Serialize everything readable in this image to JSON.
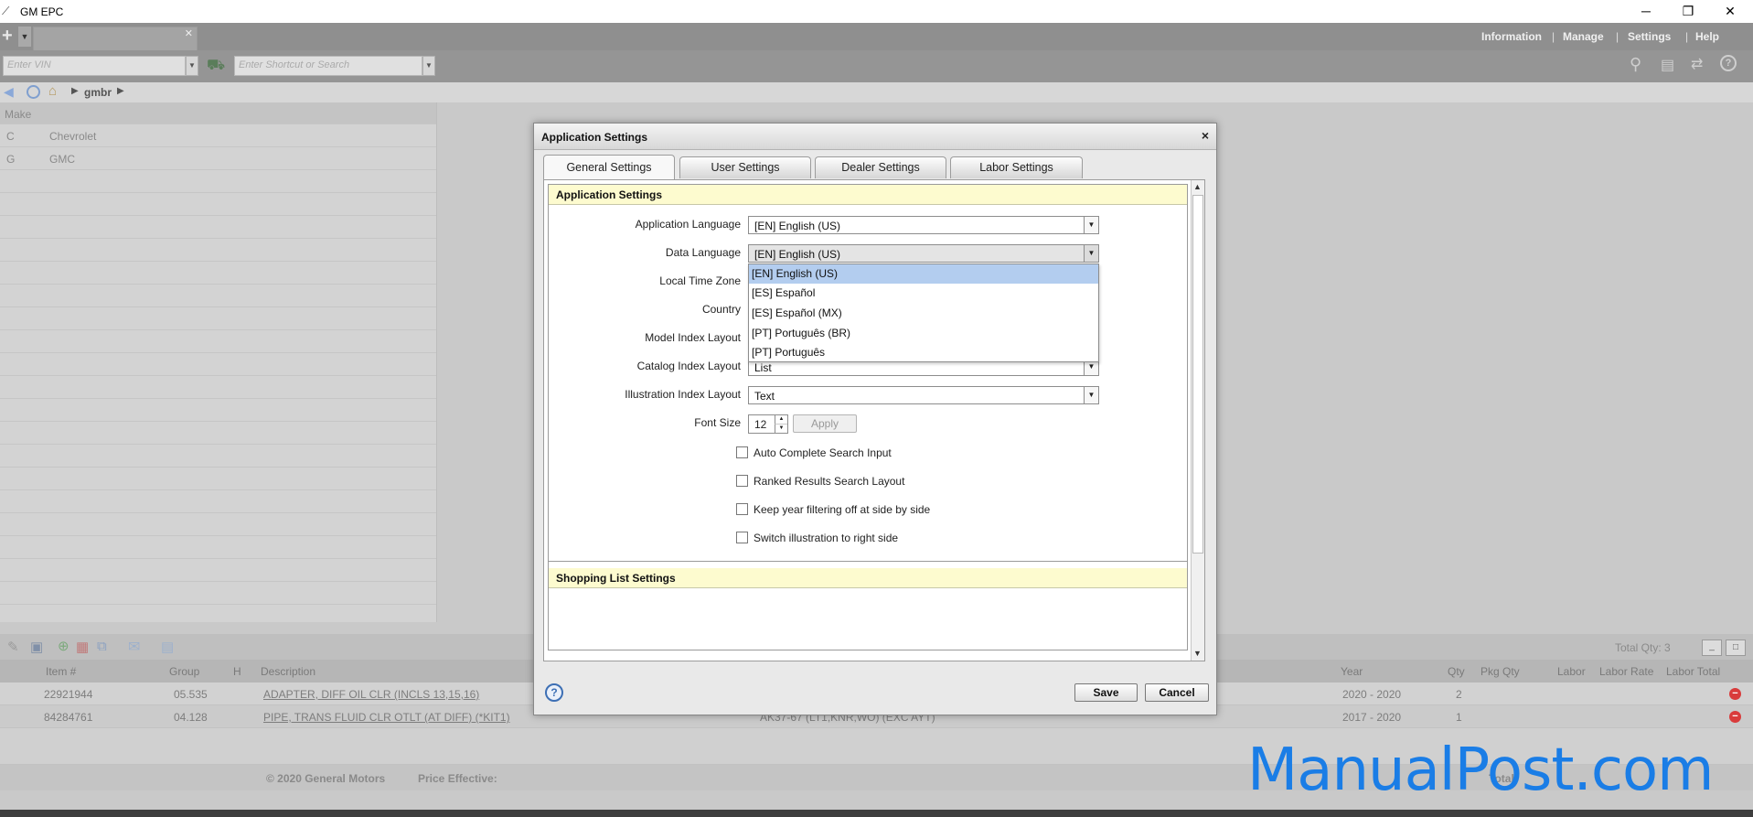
{
  "window": {
    "title": "GM EPC",
    "minimize": "─",
    "restore": "❐",
    "close": "✕"
  },
  "topmenu": {
    "information": "Information",
    "manage": "Manage",
    "settings": "Settings",
    "help": "Help"
  },
  "search": {
    "vin_placeholder": "Enter VIN",
    "shortcut_placeholder": "Enter Shortcut or Search"
  },
  "breadcrumb": {
    "item": "gmbr"
  },
  "makes": {
    "header": "Make",
    "rows": [
      {
        "code": "C",
        "name": "Chevrolet"
      },
      {
        "code": "G",
        "name": "GMC"
      }
    ]
  },
  "shopping": {
    "total_qty": "Total Qty: 3",
    "columns": {
      "item": "Item #",
      "group": "Group",
      "h": "H",
      "description": "Description",
      "year": "Year",
      "qty": "Qty",
      "pkg_qty": "Pkg Qty",
      "labor": "Labor",
      "labor_rate": "Labor Rate",
      "labor_total": "Labor Total"
    },
    "rows": [
      {
        "item": "22921944",
        "group": "05.535",
        "description": "ADAPTER, DIFF OIL CLR (INCLS 13,15,16)",
        "extra": "",
        "year": "2020 - 2020",
        "qty": "2"
      },
      {
        "item": "84284761",
        "group": "04.128",
        "description": "PIPE, TRANS FLUID CLR OTLT (AT DIFF) (*KIT1)",
        "extra": "AK37-67 (LT1,KNR,WO) (EXC AYT)",
        "year": "2017 - 2020",
        "qty": "1"
      }
    ]
  },
  "footer": {
    "copyright": "© 2020 General Motors",
    "price_effective": "Price Effective:",
    "total": "Total"
  },
  "dialog": {
    "title": "Application Settings",
    "close": "×",
    "tabs": [
      "General Settings",
      "User Settings",
      "Dealer Settings",
      "Labor Settings"
    ],
    "section_title": "Application Settings",
    "next_section_title": "Shopping List Settings",
    "fields": {
      "app_language": {
        "label": "Application Language",
        "value": "[EN] English (US)"
      },
      "data_language": {
        "label": "Data Language",
        "value": "[EN] English (US)"
      },
      "time_zone": {
        "label": "Local Time Zone"
      },
      "country": {
        "label": "Country"
      },
      "model_index": {
        "label": "Model Index Layout"
      },
      "catalog_index": {
        "label": "Catalog Index Layout",
        "value": "List"
      },
      "illustration_index": {
        "label": "Illustration Index Layout",
        "value": "Text"
      },
      "font_size": {
        "label": "Font Size",
        "value": "12",
        "apply": "Apply"
      }
    },
    "dropdown_options": [
      "[EN] English (US)",
      "[ES] Español",
      "[ES] Español (MX)",
      "[PT] Português (BR)",
      "[PT] Português"
    ],
    "checkboxes": [
      "Auto Complete Search Input",
      "Ranked Results Search Layout",
      "Keep year filtering off at side by side",
      "Switch illustration to right side"
    ],
    "save": "Save",
    "cancel": "Cancel",
    "help": "?"
  },
  "watermark": "ManualPost.com",
  "colors": {
    "highlight": "#b3cdef",
    "section_bg": "#fdfbcf",
    "watermark": "#1a7de6",
    "remove_icon": "#d93b3b"
  }
}
